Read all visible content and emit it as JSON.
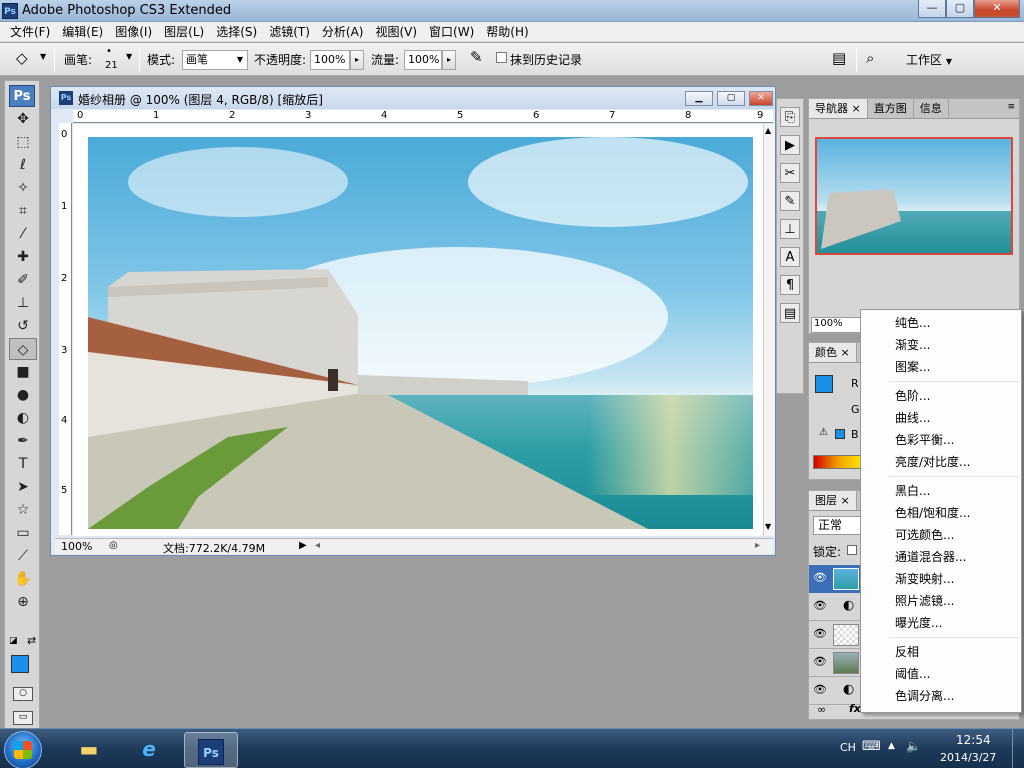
{
  "window": {
    "title": "Adobe Photoshop CS3 Extended",
    "app_icon": "Ps",
    "minimize": "—",
    "maximize": "▢",
    "close": "✕"
  },
  "menu": [
    "文件(F)",
    "编辑(E)",
    "图像(I)",
    "图层(L)",
    "选择(S)",
    "滤镜(T)",
    "分析(A)",
    "视图(V)",
    "窗口(W)",
    "帮助(H)"
  ],
  "options": {
    "brush_label": "画笔:",
    "brush_size": "21",
    "mode_label": "模式:",
    "mode_value": "画笔",
    "opacity_label": "不透明度:",
    "opacity_value": "100%",
    "flow_label": "流量:",
    "flow_value": "100%",
    "erase_history_label": "抹到历史记录",
    "workspace_label": "工作区"
  },
  "document": {
    "title": "婚纱相册 @ 100% (图层 4, RGB/8) [缩放后]",
    "icon": "Ps",
    "ruler_h": [
      "0",
      "1",
      "2",
      "3",
      "4",
      "5",
      "6",
      "7",
      "8",
      "9"
    ],
    "ruler_v": [
      "0",
      "1",
      "2",
      "3",
      "4",
      "5"
    ],
    "zoom": "100%",
    "doc_size": "文档:772.2K/4.79M"
  },
  "panels": {
    "navigator_tabs": [
      "导航器",
      "直方图",
      "信息"
    ],
    "navigator_zoom": "100%",
    "color_tab": "颜色",
    "color_r": "R",
    "color_g": "G",
    "color_b": "B",
    "layers_tab": "图层",
    "blend_mode": "正常",
    "lock_label": "锁定:"
  },
  "context_menu": {
    "group1": [
      "纯色...",
      "渐变...",
      "图案..."
    ],
    "group2": [
      "色阶...",
      "曲线...",
      "色彩平衡...",
      "亮度/对比度..."
    ],
    "group3": [
      "黑白...",
      "色相/饱和度...",
      "可选颜色...",
      "通道混合器...",
      "渐变映射...",
      "照片滤镜...",
      "曝光度..."
    ],
    "group4": [
      "反相",
      "阈值...",
      "色调分离..."
    ]
  },
  "taskbar": {
    "ime": "CH",
    "time": "12:54",
    "date": "2014/3/27",
    "ps_label": "Ps"
  },
  "colors": {
    "foreground": "#1c8fe8",
    "background": "#ffffff",
    "close_red": "#c8452a"
  }
}
